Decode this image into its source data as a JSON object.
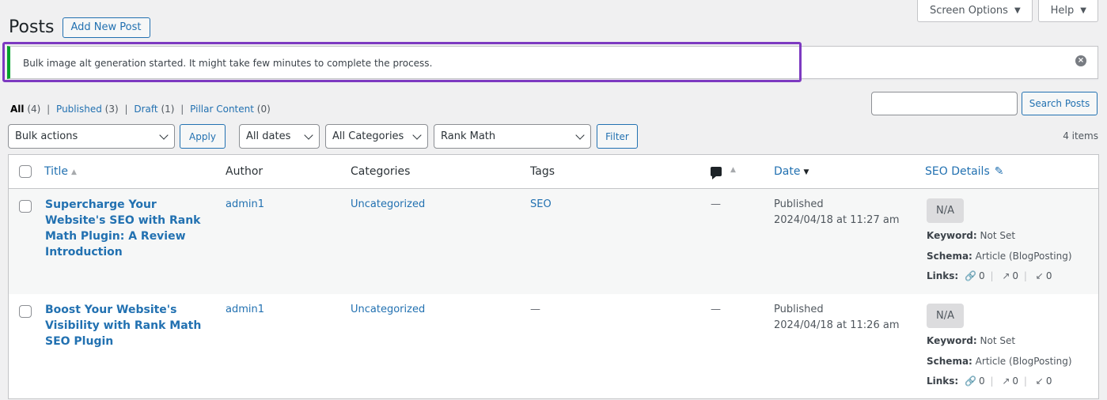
{
  "screen_meta": {
    "screen_options": "Screen Options",
    "help": "Help"
  },
  "header": {
    "title": "Posts",
    "add_new": "Add New Post"
  },
  "notice": {
    "text": "Bulk image alt generation started. It might take few minutes to complete the process."
  },
  "views": [
    {
      "label": "All",
      "count": "(4)"
    },
    {
      "label": "Published",
      "count": "(3)"
    },
    {
      "label": "Draft",
      "count": "(1)"
    },
    {
      "label": "Pillar Content",
      "count": "(0)"
    }
  ],
  "search": {
    "button": "Search Posts",
    "value": ""
  },
  "filters": {
    "bulk_actions": "Bulk actions",
    "apply": "Apply",
    "dates": "All dates",
    "categories": "All Categories",
    "seo": "Rank Math",
    "filter": "Filter",
    "items_count": "4 items"
  },
  "table": {
    "columns": {
      "title": "Title",
      "author": "Author",
      "categories": "Categories",
      "tags": "Tags",
      "date": "Date",
      "seo": "SEO Details"
    },
    "rows": [
      {
        "title": "Supercharge Your Website's SEO with Rank Math Plugin: A Review Introduction",
        "author": "admin1",
        "categories": "Uncategorized",
        "tags": "SEO",
        "comments": "—",
        "date_status": "Published",
        "date": "2024/04/18 at 11:27 am",
        "seo_score": "N/A",
        "keyword_label": "Keyword:",
        "keyword": "Not Set",
        "schema_label": "Schema:",
        "schema": "Article (BlogPosting)",
        "links_label": "Links:",
        "internal": "0",
        "external": "0",
        "incoming": "0"
      },
      {
        "title": "Boost Your Website's Visibility with Rank Math SEO Plugin",
        "author": "admin1",
        "categories": "Uncategorized",
        "tags": "—",
        "comments": "—",
        "date_status": "Published",
        "date": "2024/04/18 at 11:26 am",
        "seo_score": "N/A",
        "keyword_label": "Keyword:",
        "keyword": "Not Set",
        "schema_label": "Schema:",
        "schema": "Article (BlogPosting)",
        "links_label": "Links:",
        "internal": "0",
        "external": "0",
        "incoming": "0"
      }
    ]
  },
  "colors": {
    "accent": "#2271b1",
    "success": "#00a32a",
    "highlight": "#7d3ac1"
  }
}
